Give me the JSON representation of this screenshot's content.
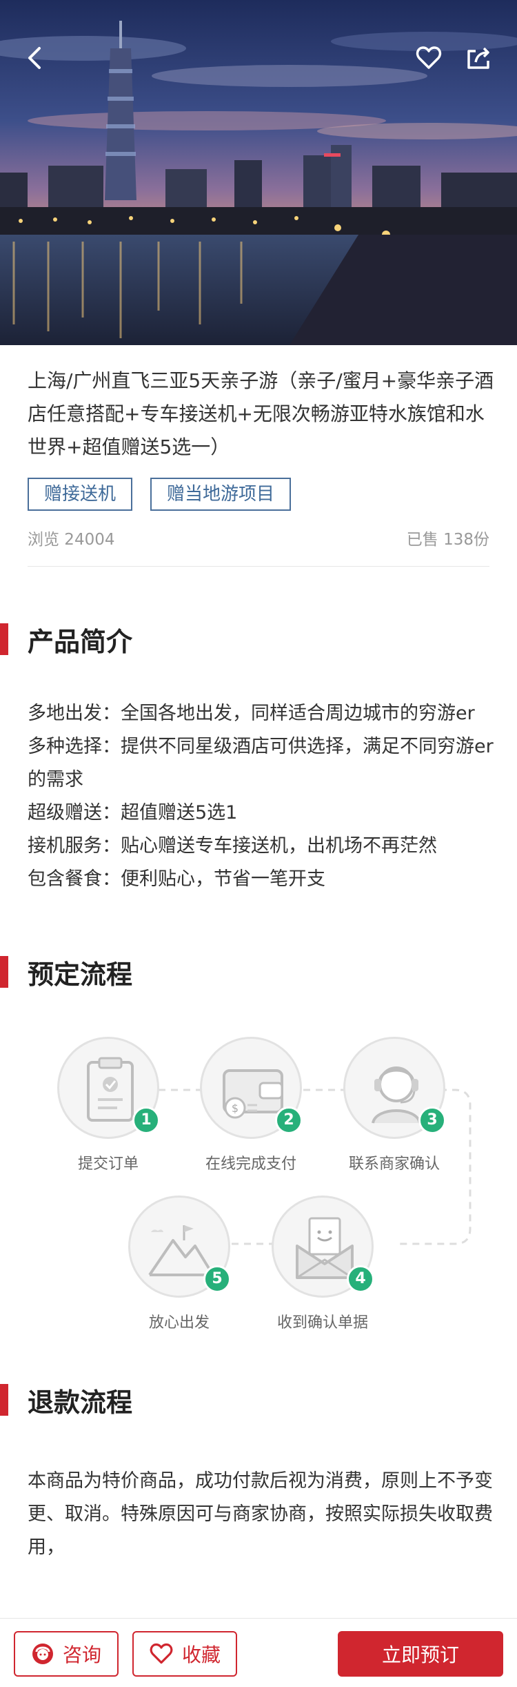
{
  "hero": {
    "back_icon": "chevron-left-icon",
    "favorite_icon": "heart-outline-icon",
    "share_icon": "share-icon"
  },
  "product": {
    "title": "上海/广州直飞三亚5天亲子游（亲子/蜜月+豪华亲子酒店任意搭配+专车接送机+无限次畅游亚特水族馆和水世界+超值赠送5选一）",
    "tags": [
      "赠接送机",
      "赠当地游项目"
    ],
    "views": "浏览 24004",
    "sold": "已售 138份"
  },
  "intro": {
    "heading": "产品简介",
    "lines": [
      "多地出发：全国各地出发，同样适合周边城市的穷游er",
      "多种选择：提供不同星级酒店可供选择，满足不同穷游er的需求",
      "超级赠送：超值赠送5选1",
      "接机服务：贴心赠送专车接送机，出机场不再茫然",
      "包含餐食：便利贴心，节省一笔开支"
    ]
  },
  "booking_flow": {
    "heading": "预定流程",
    "steps": [
      {
        "num": "1",
        "label": "提交订单",
        "icon": "clipboard-check-icon"
      },
      {
        "num": "2",
        "label": "在线完成支付",
        "icon": "wallet-icon"
      },
      {
        "num": "3",
        "label": "联系商家确认",
        "icon": "headset-agent-icon"
      },
      {
        "num": "4",
        "label": "收到确认单据",
        "icon": "envelope-letter-icon"
      },
      {
        "num": "5",
        "label": "放心出发",
        "icon": "mountain-flag-icon"
      }
    ]
  },
  "refund": {
    "heading": "退款流程",
    "text": "本商品为特价商品，成功付款后视为消费，原则上不予变更、取消。特殊原因可与商家协商，按照实际损失收取费用，"
  },
  "bottom_bar": {
    "consult_label": "咨询",
    "favorite_label": "收藏",
    "book_label": "立即预订"
  },
  "colors": {
    "accent": "#d0262f",
    "tag_blue": "#3f6a99",
    "step_green": "#27b07a"
  }
}
